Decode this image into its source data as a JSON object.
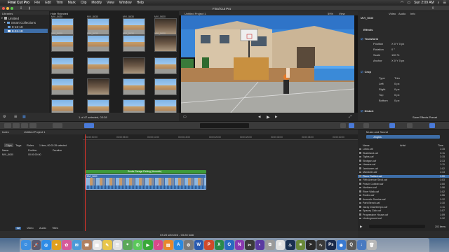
{
  "menubar": {
    "apple": "",
    "app": "Final Cut Pro",
    "items": [
      "File",
      "Edit",
      "Trim",
      "Mark",
      "Clip",
      "Modify",
      "View",
      "Window",
      "Help"
    ],
    "clock": "Sun 2:09 AM"
  },
  "window_title": "Final Cut Pro",
  "libraries": {
    "header": "Libraries",
    "items": [
      {
        "label": "Untitled"
      },
      {
        "label": "Smart Collections"
      },
      {
        "label": "8-16-18"
      },
      {
        "label": "8-24-18"
      }
    ]
  },
  "browser": {
    "filter": "Hide Rejected",
    "clip_label": "MVI_5630",
    "footer": "1 of 47 selected, 03:28"
  },
  "viewer": {
    "title": "Untitled Project 1",
    "zoom": "59%",
    "view": "View",
    "timecode": "00:00:03:28"
  },
  "inspector": {
    "tabs": [
      "Video",
      "Audio",
      "Info"
    ],
    "clip": "MVI_5630",
    "sections": {
      "effects": "Effects",
      "transform": "Transform",
      "crop": "Crop",
      "distort": "Distort"
    },
    "transform_rows": [
      {
        "label": "Position",
        "x": "0",
        "y": "0",
        "unit": "px"
      },
      {
        "label": "Rotation",
        "value": "0",
        "unit": "°"
      },
      {
        "label": "Scale",
        "value": "100",
        "unit": "%"
      },
      {
        "label": "Anchor",
        "x": "0",
        "y": "0",
        "unit": "px"
      }
    ],
    "crop_rows": [
      {
        "label": "Type",
        "value": "Trim"
      },
      {
        "label": "Left",
        "value": "0",
        "unit": "px"
      },
      {
        "label": "Right",
        "value": "0",
        "unit": "px"
      },
      {
        "label": "Top",
        "value": "0",
        "unit": "px"
      },
      {
        "label": "Bottom",
        "value": "0",
        "unit": "px"
      }
    ],
    "save_preset": "Save Effects Preset"
  },
  "timeline": {
    "project": "Untitled Project 1",
    "index_tabs": [
      "Clips",
      "Tags",
      "Roles"
    ],
    "index_summary": "1 item, 00:03:28 selected",
    "index_cols": [
      "Name",
      "Position",
      "Duration"
    ],
    "index_row": {
      "name": "MVI_5630",
      "position": "00:00:00:00",
      "duration": ""
    },
    "ruler": [
      "00:00:00:00",
      "00:00:05:00",
      "00:00:10:00",
      "00:00:15:00",
      "00:00:20:00",
      "00:00:25:00",
      "00:00:30:00",
      "00:00:35:00",
      "00:00:40:00"
    ],
    "clip_name": "MVI_5630",
    "audio_label": "Rustle Garage Fishing (Acoustic)",
    "footer": "03:28 selected - 03:28 total",
    "bottom_tabs": [
      "All",
      "Video",
      "Audio",
      "Titles"
    ]
  },
  "music": {
    "header": "Music and Sound",
    "source": "Jingles",
    "cols": [
      "Name",
      "Artist",
      "Time"
    ],
    "rows": [
      {
        "name": "Lotus.caf",
        "time": "1:15"
      },
      {
        "name": "Skateland.caf",
        "time": "3:11"
      },
      {
        "name": "Tights.caf",
        "time": "3:15"
      },
      {
        "name": "Shotgun.caf",
        "time": "2:13"
      },
      {
        "name": "Havana.caf",
        "time": "1:11"
      },
      {
        "name": "Jamboree.caf",
        "time": "1:02"
      },
      {
        "name": "Mandolin.caf",
        "time": "1:13"
      },
      {
        "name": "Piano Rattled.caf",
        "time": "1:00",
        "selected": true
      },
      {
        "name": "Fifth Avenue Stroll.caf",
        "time": "1:03"
      },
      {
        "name": "Peach Cobbler.caf",
        "time": "1:00"
      },
      {
        "name": "Northern.caf",
        "time": "1:06"
      },
      {
        "name": "River Walk.caf",
        "time": "1:02"
      },
      {
        "name": "Rodeo.caf",
        "time": "1:06"
      },
      {
        "name": "Acoustic Sunrise.caf",
        "time": "1:12"
      },
      {
        "name": "Park Bench.caf",
        "time": "1:10"
      },
      {
        "name": "Jazzy Downtempo.caf",
        "time": "1:11"
      },
      {
        "name": "Spacey Club.caf",
        "time": "1:07"
      },
      {
        "name": "Progressive House.caf",
        "time": "1:09"
      },
      {
        "name": "Underground.caf",
        "time": "1:12"
      }
    ],
    "count": "202 items"
  },
  "dock": [
    {
      "icon": "finder-icon",
      "color": "#3d8fe0",
      "glyph": "☺"
    },
    {
      "icon": "launchpad-icon",
      "color": "#5a5a70",
      "glyph": "🚀"
    },
    {
      "icon": "safari-icon",
      "color": "#2f8ce6",
      "glyph": "◎"
    },
    {
      "icon": "chrome-icon",
      "color": "#e0a020",
      "glyph": "●"
    },
    {
      "icon": "photos-icon",
      "color": "#d65a9a",
      "glyph": "✿"
    },
    {
      "icon": "mail-icon",
      "color": "#4a9ad8",
      "glyph": "✉"
    },
    {
      "icon": "contacts-icon",
      "color": "#b08060",
      "glyph": "☎"
    },
    {
      "icon": "calendar-icon",
      "color": "#e8e8e8",
      "glyph": "▦"
    },
    {
      "icon": "notes-icon",
      "color": "#e8c64a",
      "glyph": "✎"
    },
    {
      "icon": "reminders-icon",
      "color": "#e0e0e0",
      "glyph": "☰"
    },
    {
      "icon": "maps-icon",
      "color": "#5aa858",
      "glyph": "⌖"
    },
    {
      "icon": "messages-icon",
      "color": "#5ac85a",
      "glyph": "✆"
    },
    {
      "icon": "facetime-icon",
      "color": "#3aa83a",
      "glyph": "▶"
    },
    {
      "icon": "itunes-icon",
      "color": "#d84a8a",
      "glyph": "♪"
    },
    {
      "icon": "ibooks-icon",
      "color": "#e8882a",
      "glyph": "▤"
    },
    {
      "icon": "appstore-icon",
      "color": "#2a8ae0",
      "glyph": "A"
    },
    {
      "icon": "preferences-icon",
      "color": "#7a7a7a",
      "glyph": "⚙"
    },
    {
      "icon": "word-icon",
      "color": "#2a5ab0",
      "glyph": "W"
    },
    {
      "icon": "powerpoint-icon",
      "color": "#d04a2a",
      "glyph": "P"
    },
    {
      "icon": "excel-icon",
      "color": "#2a8a4a",
      "glyph": "X"
    },
    {
      "icon": "outlook-icon",
      "color": "#2a6ac0",
      "glyph": "O"
    },
    {
      "icon": "onenote-icon",
      "color": "#8a3ab0",
      "glyph": "N"
    },
    {
      "icon": "finalcut-icon",
      "color": "#3a3a3a",
      "glyph": "✂"
    },
    {
      "icon": "motion-icon",
      "color": "#5a3aa0",
      "glyph": "◐"
    },
    {
      "icon": "compressor-icon",
      "color": "#9a9a9a",
      "glyph": "⧉"
    },
    {
      "icon": "roblox-icon",
      "color": "#e0e0e0",
      "glyph": "R"
    },
    {
      "icon": "steam-icon",
      "color": "#1a3050",
      "glyph": "♨"
    },
    {
      "icon": "minecraft-icon",
      "color": "#6a8a3a",
      "glyph": "■"
    },
    {
      "icon": "terminal-icon",
      "color": "#2a2a2a",
      "glyph": ">"
    },
    {
      "icon": "activity-icon",
      "color": "#3a3a3a",
      "glyph": "∿"
    },
    {
      "icon": "photoshop-icon",
      "color": "#1a2a4a",
      "glyph": "Ps"
    },
    {
      "icon": "screenflow-icon",
      "color": "#3a7ad0",
      "glyph": "◉"
    },
    {
      "icon": "quicktime-icon",
      "color": "#5a5a5a",
      "glyph": "Q"
    },
    {
      "icon": "downloads-icon",
      "color": "#4a7ac0",
      "glyph": "↓"
    },
    {
      "icon": "trash-icon",
      "color": "#b8b8b8",
      "glyph": "🗑"
    }
  ]
}
